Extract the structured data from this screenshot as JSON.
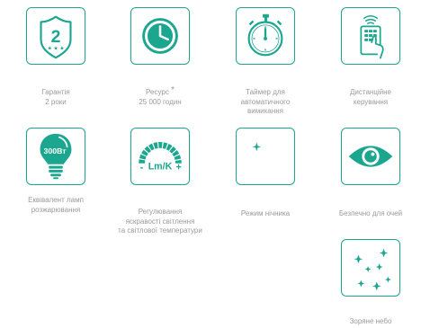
{
  "colors": {
    "accent": "#1aa68f",
    "text": "#9a9a9a",
    "border": "#1aa68f"
  },
  "features": [
    {
      "icon": "shield-number-icon",
      "badge": "2",
      "label_lines": [
        "Гарантія",
        "2 роки"
      ]
    },
    {
      "icon": "clock-icon",
      "label_lines": [
        "Ресурс",
        "25 000 годин"
      ],
      "asterisk": "*"
    },
    {
      "icon": "stopwatch-icon",
      "label_lines": [
        "Таймер для",
        "автоматичного",
        "вимикання"
      ]
    },
    {
      "icon": "remote-control-icon",
      "label_lines": [
        "Дистанційне",
        "керування"
      ]
    },
    {
      "icon": "light-bulb-icon",
      "badge": "300Вт",
      "label_lines": [
        "Еквівалент ламп",
        "розжарювання"
      ]
    },
    {
      "icon": "brightness-dial-icon",
      "badge": "Lm/K",
      "minus": "-",
      "plus": "+",
      "label_lines": [
        "Регулювання",
        "яскравості світлення",
        "та світлової температури"
      ]
    },
    {
      "icon": "moon-star-icon",
      "label_lines": [
        "Режим нічника"
      ]
    },
    {
      "icon": "eye-icon",
      "label_lines": [
        "Безпечно для очей"
      ]
    },
    {
      "icon": "stars-icon",
      "label_lines": [
        "Зоряне небо"
      ]
    }
  ]
}
